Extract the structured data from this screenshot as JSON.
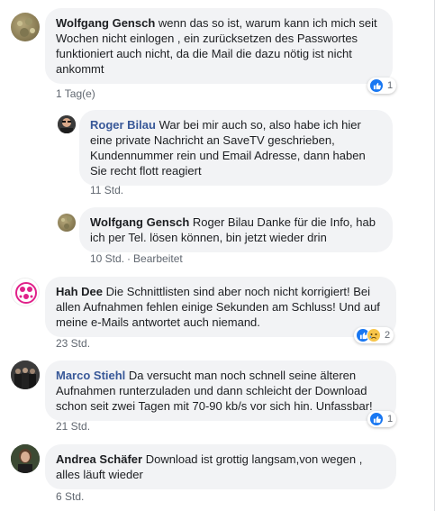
{
  "comments": [
    {
      "author": "Wolfgang Gensch",
      "text": "wenn das so ist, warum kann ich mich seit Wochen nicht einlogen , ein zurücksetzen des Passwortes funktioniert auch nicht, da die Mail die dazu nötig ist nicht ankommt",
      "time": "1 Tag(e)",
      "reaction_count": "1"
    },
    {
      "author": "Roger Bilau",
      "text": "War bei mir auch so, also habe ich hier eine private Nachricht an SaveTV geschrieben, Kundennummer rein und Email Adresse, dann haben Sie recht flott reagiert",
      "time": "11 Std."
    },
    {
      "author": "Wolfgang Gensch",
      "text": "Roger Bilau Danke für die Info, hab ich per Tel. lösen können, bin jetzt wieder drin",
      "time": "10 Std.",
      "edited": "Bearbeitet"
    },
    {
      "author": "Hah Dee",
      "text": "Die Schnittlisten sind aber noch nicht korrigiert! Bei allen Aufnahmen fehlen einige Sekunden am Schluss! Und auf meine e-Mails antwortet auch niemand.",
      "time": "23 Std.",
      "reaction_count": "2"
    },
    {
      "author": "Marco Stiehl",
      "text": "Da versucht man noch schnell seine älteren Aufnahmen runterzuladen und dann schleicht der Download schon seit zwei Tagen mit 70-90 kb/s vor sich hin. Unfassbar!",
      "time": "21 Std.",
      "reaction_count": "1"
    },
    {
      "author": "Andrea Schäfer",
      "text": "Download ist grottig langsam,von wegen , alles läuft wieder",
      "time": "6 Std."
    }
  ],
  "colors": {
    "bubble": "#f2f3f5",
    "author": "#385898",
    "meta": "#606770",
    "like": "#1877f2",
    "sad": "#f7c54b"
  },
  "icons": [
    "like-reaction-icon",
    "sad-reaction-icon"
  ]
}
